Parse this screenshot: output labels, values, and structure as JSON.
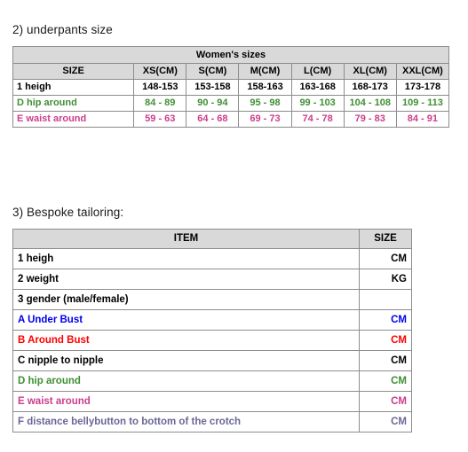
{
  "sections": {
    "underpants": {
      "heading": "2) underpants size",
      "table": {
        "title": "Women's sizes",
        "columns": [
          "SIZE",
          "XS(CM)",
          "S(CM)",
          "M(CM)",
          "L(CM)",
          "XL(CM)",
          "XXL(CM)"
        ],
        "rows": [
          {
            "label": "1 heigh",
            "color": "#000000",
            "color_name": "black",
            "values": [
              "148-153",
              "153-158",
              "158-163",
              "163-168",
              "168-173",
              "173-178"
            ]
          },
          {
            "label": "D hip around",
            "color": "#3f8f33",
            "color_name": "green",
            "values": [
              "84 - 89",
              "90 - 94",
              "95 - 98",
              "99 - 103",
              "104 - 108",
              "109 - 113"
            ]
          },
          {
            "label": "E waist around",
            "color": "#cc3d8c",
            "color_name": "pink",
            "values": [
              "59 - 63",
              "64 - 68",
              "69 - 73",
              "74 - 78",
              "79 - 83",
              "84 - 91"
            ]
          }
        ]
      }
    },
    "bespoke": {
      "heading": "3) Bespoke tailoring:",
      "table": {
        "columns": [
          "ITEM",
          "SIZE"
        ],
        "rows": [
          {
            "item": "1 heigh",
            "unit": "CM",
            "color": "#000000",
            "color_name": "black"
          },
          {
            "item": "2 weight",
            "unit": "KG",
            "color": "#000000",
            "color_name": "black"
          },
          {
            "item": "3 gender (male/female)",
            "unit": "",
            "color": "#000000",
            "color_name": "black"
          },
          {
            "item": "A Under Bust",
            "unit": "CM",
            "color": "#0000ee",
            "color_name": "blue"
          },
          {
            "item": "B Around Bust",
            "unit": "CM",
            "color": "#fe0000",
            "color_name": "red"
          },
          {
            "item": "C nipple to nipple",
            "unit": "CM",
            "color": "#000000",
            "color_name": "black"
          },
          {
            "item": "D hip around",
            "unit": "CM",
            "color": "#3f8f33",
            "color_name": "green"
          },
          {
            "item": "E waist around",
            "unit": "CM",
            "color": "#cc3d8c",
            "color_name": "pink"
          },
          {
            "item": "F distance bellybutton to bottom of the crotch",
            "unit": "CM",
            "color": "#6a6796",
            "color_name": "slate"
          }
        ]
      }
    }
  },
  "palette": {
    "header_background": "#d9d9d9",
    "grid_line": "#8c8c8c",
    "outer_border": "#6e6e6e",
    "page_background": "#ffffff",
    "black": "#000000",
    "green": "#3f8f33",
    "pink": "#cc3d8c",
    "blue": "#0000ee",
    "red": "#fe0000",
    "slate": "#6a6796"
  }
}
